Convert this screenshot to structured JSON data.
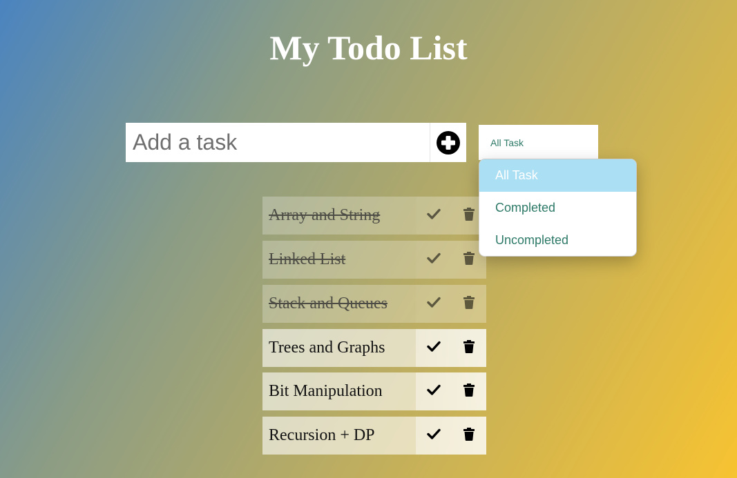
{
  "header": {
    "title": "My Todo List"
  },
  "input": {
    "placeholder": "Add a task",
    "value": ""
  },
  "add_button": {
    "icon": "plus-circle-icon"
  },
  "filter": {
    "selected": "All Task",
    "options": [
      "All Task",
      "Completed",
      "Uncompleted"
    ],
    "highlighted_option": "All Task",
    "open": true
  },
  "todos": [
    {
      "text": "Array and String",
      "completed": true
    },
    {
      "text": "Linked List",
      "completed": true
    },
    {
      "text": "Stack and Queues",
      "completed": true
    },
    {
      "text": "Trees and Graphs",
      "completed": false
    },
    {
      "text": "Bit Manipulation",
      "completed": false
    },
    {
      "text": "Recursion + DP",
      "completed": false
    }
  ],
  "icons": {
    "complete": "check-icon",
    "delete": "trash-icon"
  },
  "colors": {
    "gradient_start": "#4a84c0",
    "gradient_end": "#f7c331",
    "accent_text": "#2e7a68",
    "dropdown_highlight": "#abdff3"
  }
}
